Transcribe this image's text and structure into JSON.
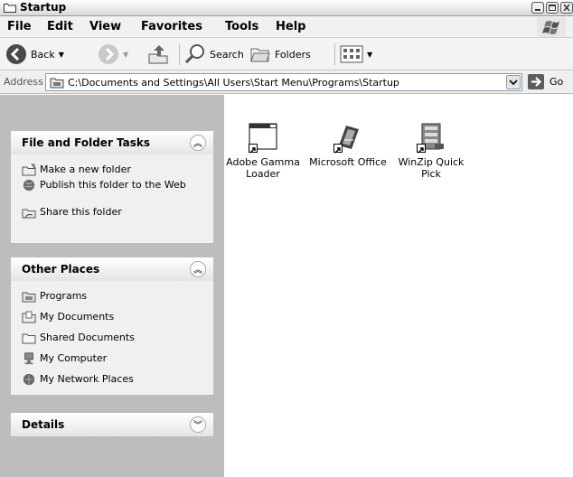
{
  "window": {
    "title": "Startup"
  },
  "menu": {
    "items": [
      "File",
      "Edit",
      "View",
      "Favorites",
      "Tools",
      "Help"
    ]
  },
  "toolbar": {
    "back": "Back",
    "search": "Search",
    "folders": "Folders"
  },
  "address": {
    "label": "Address",
    "value": "C:\\Documents and Settings\\All Users\\Start Menu\\Programs\\Startup",
    "go": "Go"
  },
  "panels": {
    "file_tasks": {
      "title": "File and Folder Tasks",
      "items": [
        {
          "label": "Make a new folder",
          "icon": "new-folder-icon"
        },
        {
          "label": "Publish this folder to the Web",
          "icon": "web-publish-icon"
        },
        {
          "label": "Share this folder",
          "icon": "share-folder-icon"
        }
      ]
    },
    "other_places": {
      "title": "Other Places",
      "items": [
        {
          "label": "Programs",
          "icon": "programs-folder-icon"
        },
        {
          "label": "My Documents",
          "icon": "my-documents-icon"
        },
        {
          "label": "Shared Documents",
          "icon": "shared-documents-icon"
        },
        {
          "label": "My Computer",
          "icon": "my-computer-icon"
        },
        {
          "label": "My Network Places",
          "icon": "network-places-icon"
        }
      ]
    },
    "details": {
      "title": "Details"
    }
  },
  "files": [
    {
      "label": "Adobe Gamma Loader",
      "icon": "adobe-gamma-icon"
    },
    {
      "label": "Microsoft Office",
      "icon": "microsoft-office-icon"
    },
    {
      "label": "WinZip Quick Pick",
      "icon": "winzip-icon"
    }
  ]
}
